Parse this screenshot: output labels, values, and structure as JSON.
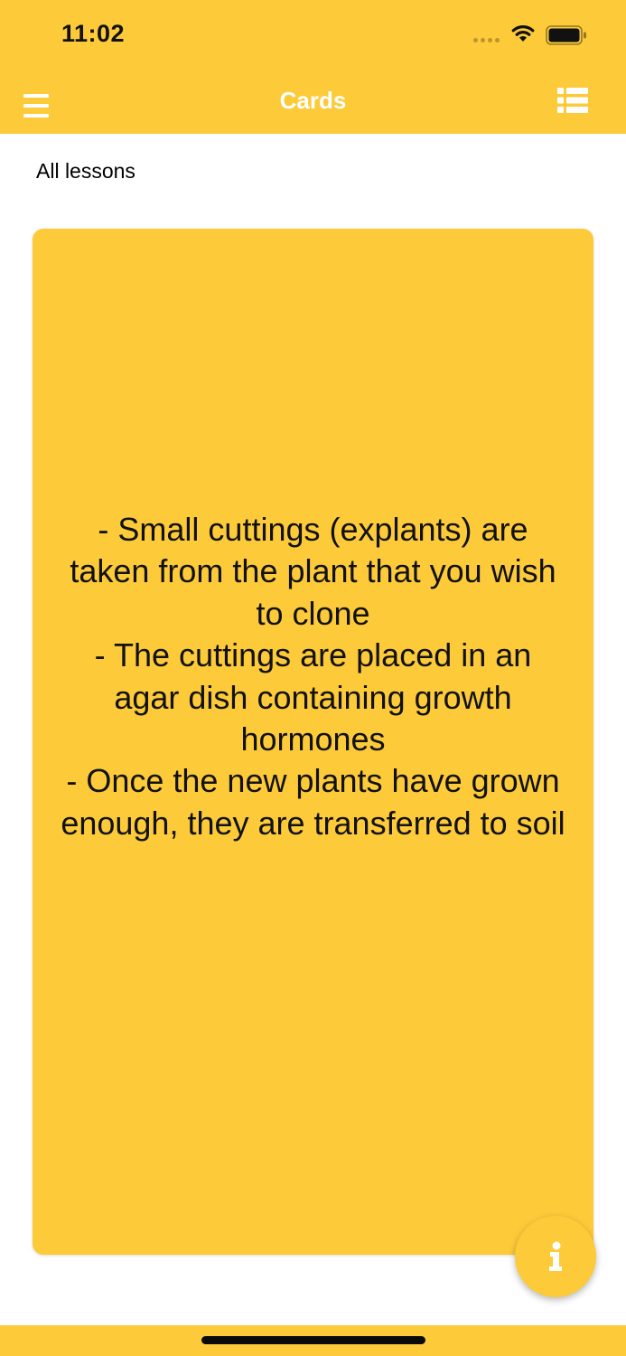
{
  "status_bar": {
    "time": "11:02"
  },
  "nav": {
    "title": "Cards",
    "menu_icon": "hamburger-icon",
    "list_icon": "list-view-icon"
  },
  "lesson_filter": {
    "label": "All lessons"
  },
  "card": {
    "lines": [
      "- Small cuttings (explants) are",
      "taken from the plant that you wish",
      "to clone",
      "- The cuttings are placed in an",
      "agar dish containing growth",
      "hormones",
      "- Once the new plants have grown",
      "enough, they are transferred to soil"
    ]
  },
  "info_button": {
    "icon": "info-icon"
  },
  "colors": {
    "accent": "#fdca39",
    "header_text": "#ffffff",
    "body_text": "#111111"
  }
}
